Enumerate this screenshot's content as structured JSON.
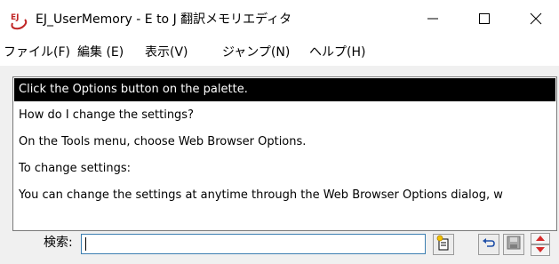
{
  "window": {
    "title": "EJ_UserMemory - E to J 翻訳メモリエディタ",
    "icon_label": "EJ",
    "min_icon": "minimize-icon",
    "max_icon": "maximize-icon",
    "close_icon": "close-icon"
  },
  "menu": {
    "file": "ファイル(F)",
    "edit": "編集 (E)",
    "view": "表示(V)",
    "jump": "ジャンプ(N)",
    "help": "ヘルプ(H)"
  },
  "list": {
    "items": [
      "Click the Options button on the palette.",
      "How do I change the settings?",
      "On the Tools menu, choose Web Browser Options.",
      "To change settings:",
      "You can change the settings at anytime through the Web Browser Options dialog, w"
    ],
    "selected_index": 0
  },
  "search": {
    "label": "検索:",
    "value": "",
    "placeholder": ""
  },
  "toolbar": {
    "new_icon": "new-entry-icon",
    "undo_icon": "undo-icon",
    "save_icon": "save-icon",
    "spinner_icon": "up-down-arrows-icon"
  },
  "colors": {
    "selection_bg": "#000000",
    "selection_fg": "#ffffff",
    "icon_red": "#d62b2b",
    "input_border": "#3c7fb1"
  }
}
